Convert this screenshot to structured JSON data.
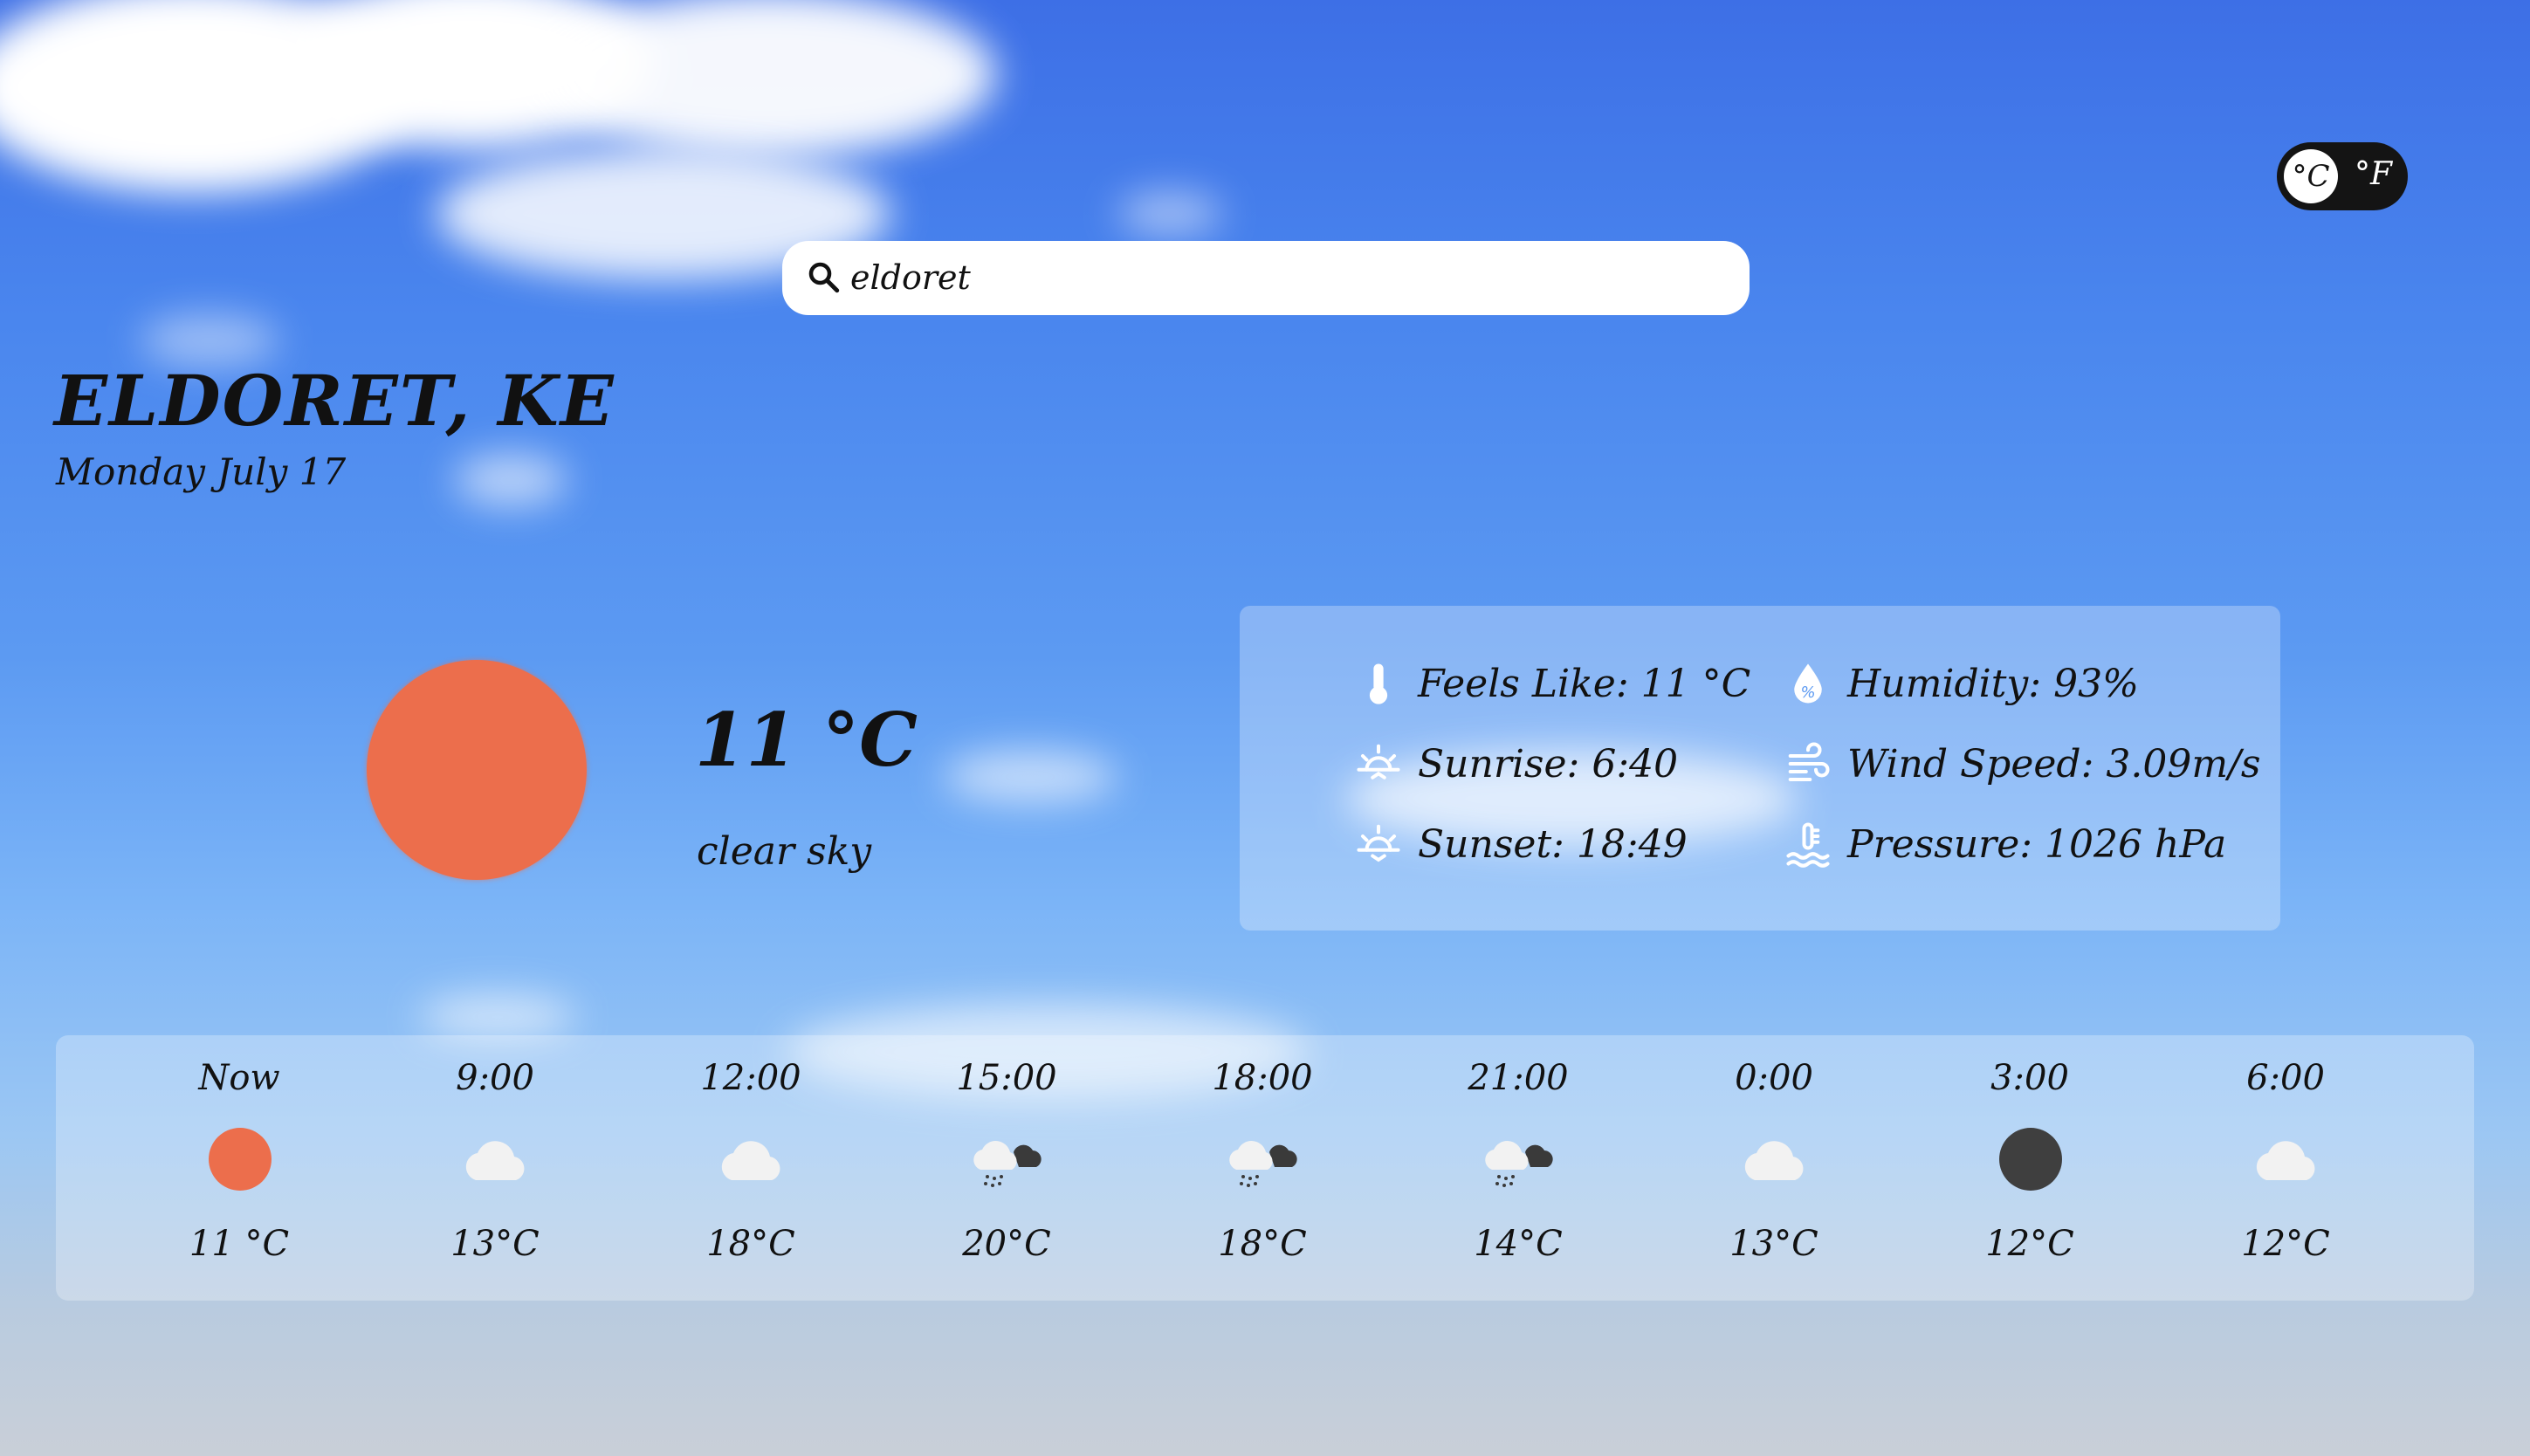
{
  "unit_toggle": {
    "celsius_label": "°C",
    "fahrenheit_label": "°F",
    "selected": "celsius"
  },
  "search": {
    "value": "eldoret",
    "placeholder": ""
  },
  "location": {
    "city": "ELDORET, KE",
    "date": "Monday July 17"
  },
  "current": {
    "temperature": "11 °C",
    "description": "clear sky",
    "icon": "sun-icon",
    "icon_color": "#ec6e4c"
  },
  "details": {
    "feels_like": "Feels Like: 11 °C",
    "humidity": "Humidity: 93%",
    "sunrise": "Sunrise: 6:40",
    "wind_speed": "Wind Speed: 3.09m/s",
    "sunset": "Sunset: 18:49",
    "pressure": "Pressure: 1026 hPa"
  },
  "forecast": [
    {
      "time": "Now",
      "temp": "11 °C",
      "icon": "sun-icon"
    },
    {
      "time": "9:00",
      "temp": "13°C",
      "icon": "cloud-icon"
    },
    {
      "time": "12:00",
      "temp": "18°C",
      "icon": "cloud-icon"
    },
    {
      "time": "15:00",
      "temp": "20°C",
      "icon": "rain-cloud-icon"
    },
    {
      "time": "18:00",
      "temp": "18°C",
      "icon": "rain-cloud-icon"
    },
    {
      "time": "21:00",
      "temp": "14°C",
      "icon": "rain-cloud-icon"
    },
    {
      "time": "0:00",
      "temp": "13°C",
      "icon": "cloud-icon"
    },
    {
      "time": "3:00",
      "temp": "12°C",
      "icon": "moon-icon"
    },
    {
      "time": "6:00",
      "temp": "12°C",
      "icon": "cloud-icon"
    }
  ],
  "colors": {
    "sun": "#ec6e4c",
    "moon": "#3f3f3f",
    "cloud": "#f2f2f2",
    "dark_cloud": "#3a3a3a",
    "toggle_bg": "#141414"
  }
}
